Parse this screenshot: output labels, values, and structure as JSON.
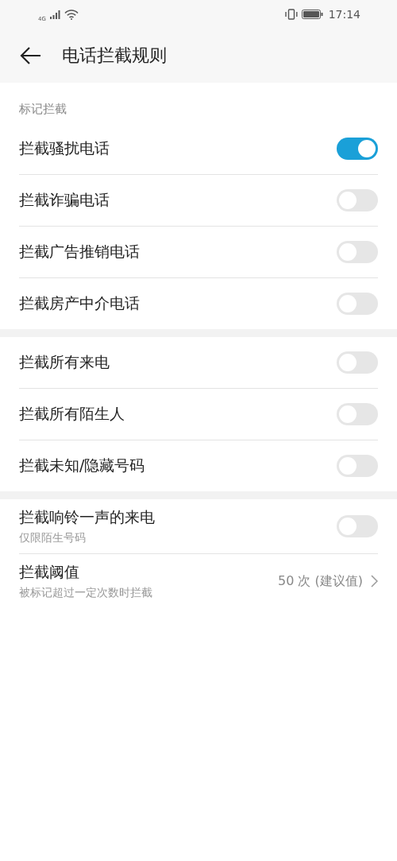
{
  "status_bar": {
    "network": "4G",
    "time": "17:14"
  },
  "header": {
    "title": "电话拦截规则"
  },
  "groups": [
    {
      "title": "标记拦截",
      "rows": [
        {
          "kind": "toggle",
          "label": "拦截骚扰电话",
          "on": true
        },
        {
          "kind": "toggle",
          "label": "拦截诈骗电话",
          "on": false
        },
        {
          "kind": "toggle",
          "label": "拦截广告推销电话",
          "on": false
        },
        {
          "kind": "toggle",
          "label": "拦截房产中介电话",
          "on": false
        }
      ]
    },
    {
      "rows": [
        {
          "kind": "toggle",
          "label": "拦截所有来电",
          "on": false
        },
        {
          "kind": "toggle",
          "label": "拦截所有陌生人",
          "on": false
        },
        {
          "kind": "toggle",
          "label": "拦截未知/隐藏号码",
          "on": false
        }
      ]
    },
    {
      "rows": [
        {
          "kind": "toggle",
          "label": "拦截响铃一声的来电",
          "sublabel": "仅限陌生号码",
          "on": false
        },
        {
          "kind": "value",
          "label": "拦截阈值",
          "sublabel": "被标记超过一定次数时拦截",
          "value": "50 次 (建议值)"
        }
      ]
    }
  ]
}
